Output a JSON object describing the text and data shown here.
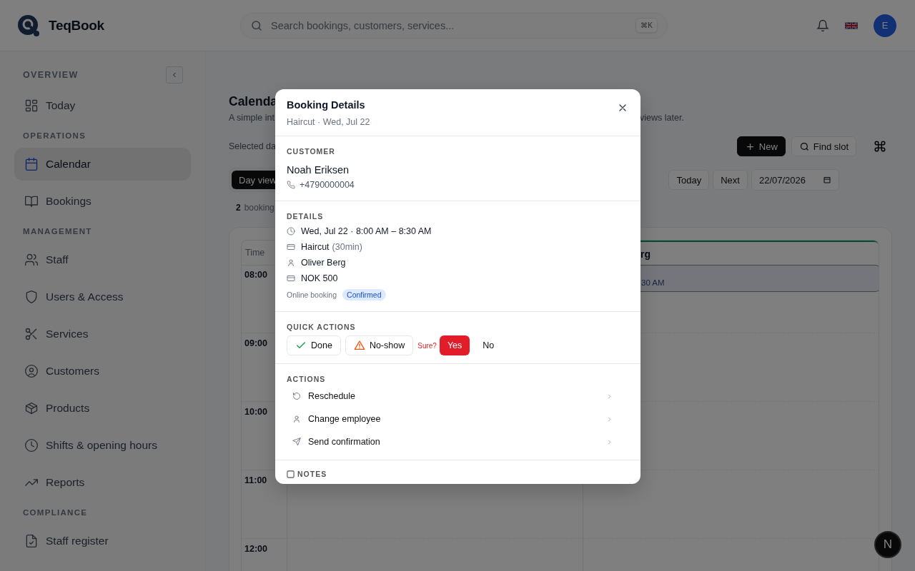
{
  "app": {
    "name": "TeqBook"
  },
  "search": {
    "placeholder": "Search bookings, customers, services...",
    "shortcut": "⌘K"
  },
  "user": {
    "initial": "E"
  },
  "sidebar": {
    "sections": [
      {
        "title": "OVERVIEW",
        "items": [
          {
            "kind": "today",
            "label": "Today",
            "selected": false
          }
        ]
      },
      {
        "title": "OPERATIONS",
        "items": [
          {
            "kind": "calendar",
            "label": "Calendar",
            "selected": true
          },
          {
            "kind": "bookings",
            "label": "Bookings",
            "selected": false
          }
        ]
      },
      {
        "title": "MANAGEMENT",
        "items": [
          {
            "kind": "staff",
            "label": "Staff",
            "selected": false
          },
          {
            "kind": "users",
            "label": "Users & Access",
            "selected": false
          },
          {
            "kind": "services",
            "label": "Services",
            "selected": false
          },
          {
            "kind": "customers",
            "label": "Customers",
            "selected": false
          },
          {
            "kind": "products",
            "label": "Products",
            "selected": false
          },
          {
            "kind": "shifts",
            "label": "Shifts & opening hours",
            "selected": false
          },
          {
            "kind": "reports",
            "label": "Reports",
            "selected": false
          }
        ]
      },
      {
        "title": "COMPLIANCE",
        "items": [
          {
            "kind": "register",
            "label": "Staff register",
            "selected": false
          }
        ]
      }
    ]
  },
  "page": {
    "title": "Calenda",
    "subtitle_start": "A simple int",
    "subtitle_end": "views later.",
    "selected_date_label": "Selected da",
    "new_button": "New",
    "find_slot_button": "Find slot",
    "view_tabs": [
      {
        "label": "Day view",
        "selected": true
      }
    ],
    "today_button": "Today",
    "next_button": "Next",
    "date_value": "22/07/2026",
    "booking_count": "2",
    "booking_count_label": "booking"
  },
  "calendar": {
    "time_header": "Time",
    "hours": [
      "08:00",
      "09:00",
      "10:00",
      "11:00",
      "12:00"
    ],
    "column_2_header": "rg",
    "column_2_booking": "30 AM"
  },
  "modal": {
    "title": "Booking Details",
    "subtitle": "Haircut · Wed, Jul 22",
    "customer": {
      "heading": "CUSTOMER",
      "name": "Noah Eriksen",
      "phone": "+4790000004"
    },
    "details": {
      "heading": "DETAILS",
      "rows": [
        {
          "kind": "time",
          "text": "Wed, Jul 22 · 8:00 AM – 8:30 AM"
        },
        {
          "kind": "service",
          "text": "Haircut",
          "note": "(30min)"
        },
        {
          "kind": "employee",
          "text": "Oliver Berg"
        },
        {
          "kind": "price",
          "text": "NOK 500"
        }
      ],
      "source": "Online booking",
      "status": "Confirmed"
    },
    "quick_actions": {
      "heading": "QUICK ACTIONS",
      "buttons": [
        {
          "kind": "done",
          "label": "Done"
        },
        {
          "kind": "no_show",
          "label": "No-show"
        }
      ],
      "confirm_prompt": "Sure?",
      "confirm_yes": "Yes",
      "confirm_no": "No"
    },
    "actions": {
      "heading": "ACTIONS",
      "items": [
        {
          "kind": "reschedule",
          "label": "Reschedule"
        },
        {
          "kind": "employee",
          "label": "Change employee"
        },
        {
          "kind": "send",
          "label": "Send confirmation"
        }
      ]
    },
    "notes": {
      "heading": "NOTES"
    }
  },
  "dev_badge": {
    "letter": "N"
  }
}
